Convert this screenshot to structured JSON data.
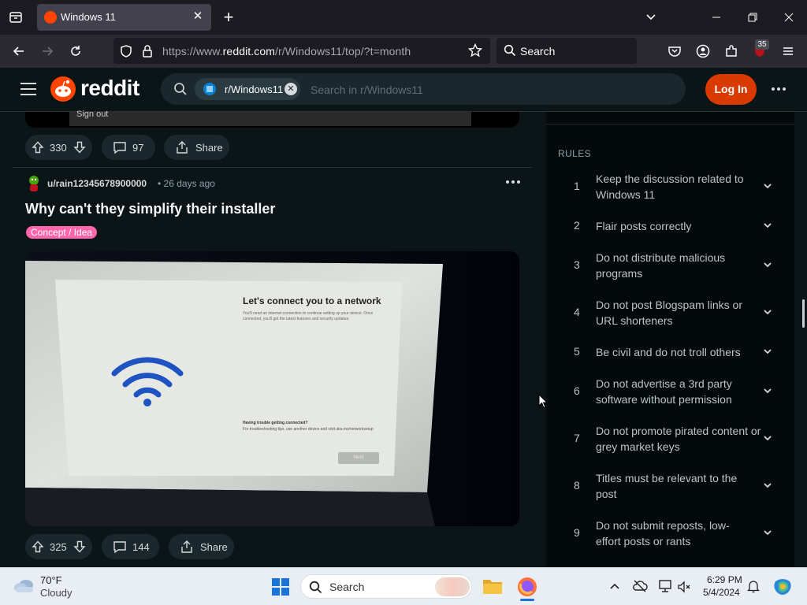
{
  "browser": {
    "tab_title": "Windows 11",
    "new_tab_symbol": "+",
    "url_prefix": "https://www.",
    "url_domain": "reddit.com",
    "url_path": "/r/Windows11/top/?t=month",
    "search_placeholder": "Search",
    "extension_badge": "35"
  },
  "reddit": {
    "logo_text": "reddit",
    "subreddit_chip": "r/Windows11",
    "search_placeholder": "Search in r/Windows11",
    "login_label": "Log In"
  },
  "previous_post": {
    "menu_item": "Sign out",
    "upvotes": "330",
    "comments": "97",
    "share_label": "Share"
  },
  "post": {
    "author": "u/rain12345678900000",
    "time_ago": "• 26 days ago",
    "title": "Why can't they simplify their installer",
    "flair": "Concept / Idea",
    "upvotes": "325",
    "comments": "144",
    "share_label": "Share",
    "image": {
      "heading": "Let's connect you to a network",
      "body": "You'll need an internet connection to continue setting up your device. Once connected, you'll get the latest features and security updates.",
      "trouble_heading": "Having trouble getting connected?",
      "trouble_body": "For troubleshooting tips, use another device and visit aka.ms/networksetup",
      "next_button": "Next"
    }
  },
  "sidebar": {
    "rules_heading": "RULES",
    "rules": [
      {
        "num": "1",
        "text": "Keep the discussion related to Windows 11"
      },
      {
        "num": "2",
        "text": "Flair posts correctly"
      },
      {
        "num": "3",
        "text": "Do not distribute malicious programs"
      },
      {
        "num": "4",
        "text": "Do not post Blogspam links or URL shorteners"
      },
      {
        "num": "5",
        "text": "Be civil and do not troll others"
      },
      {
        "num": "6",
        "text": "Do not advertise a 3rd party software without permission"
      },
      {
        "num": "7",
        "text": "Do not promote pirated content or grey market keys"
      },
      {
        "num": "8",
        "text": "Titles must be relevant to the post"
      },
      {
        "num": "9",
        "text": "Do not submit reposts, low-effort posts or rants"
      }
    ]
  },
  "taskbar": {
    "weather_temp": "70°F",
    "weather_desc": "Cloudy",
    "search_placeholder": "Search",
    "time": "6:29 PM",
    "date": "5/4/2024"
  },
  "colors": {
    "reddit_orange": "#ff4500",
    "login_button": "#d93a00",
    "flair_pink": "#ff66ac",
    "page_bg": "#0b1416"
  }
}
